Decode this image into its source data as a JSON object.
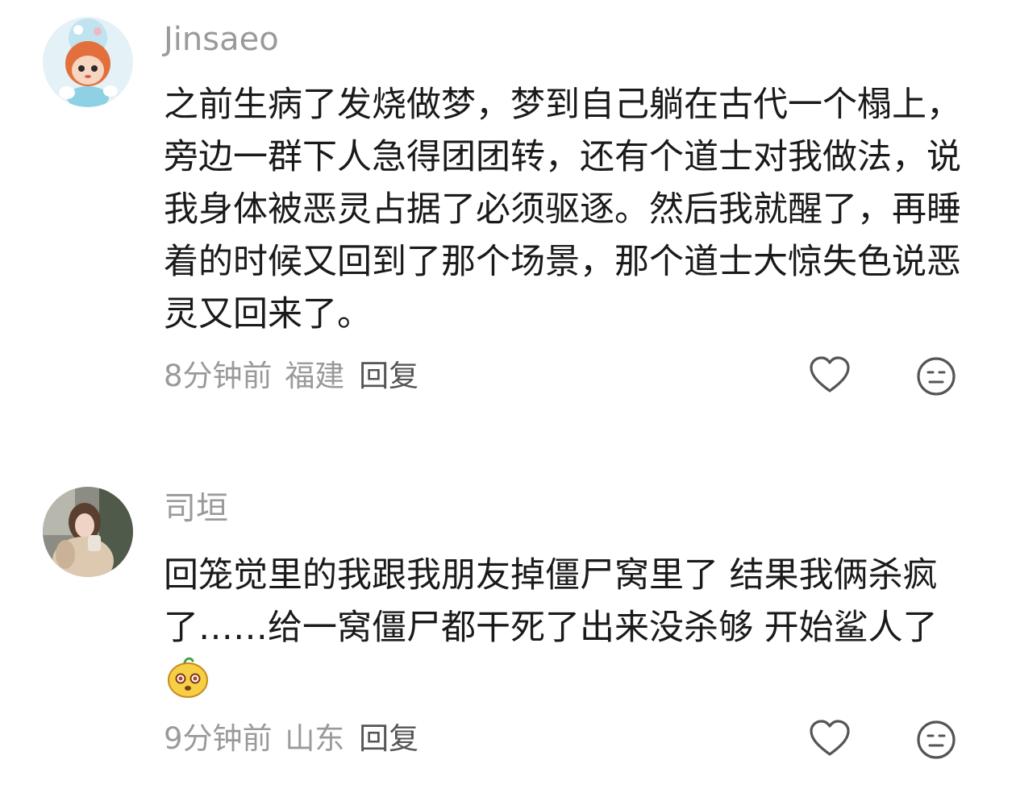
{
  "comments": [
    {
      "username": "Jinsaeo",
      "text": "之前生病了发烧做梦，梦到自己躺在古代一个榻上，旁边一群下人急得团团转，还有个道士对我做法，说我身体被恶灵占据了必须驱逐。然后我就醒了，再睡着的时候又回到了那个场景，那个道士大惊失色说恶灵又回来了。",
      "time": "8分钟前",
      "location": "福建",
      "reply_label": "回复"
    },
    {
      "username": "司垣",
      "text": "回笼觉里的我跟我朋友掉僵尸窝里了 结果我俩杀疯了……给一窝僵尸都干死了出来没杀够 开始鲨人了",
      "time": "9分钟前",
      "location": "山东",
      "reply_label": "回复"
    }
  ],
  "icons": {
    "like": "heart-outline-icon",
    "dislike": "neutral-face-icon",
    "inline_emoji": "cute-face-emoji-icon"
  },
  "colors": {
    "username": "#9a9a9a",
    "text": "#1a1a1a",
    "meta": "#9a9a9a",
    "reply": "#555555",
    "icon": "#555555"
  }
}
